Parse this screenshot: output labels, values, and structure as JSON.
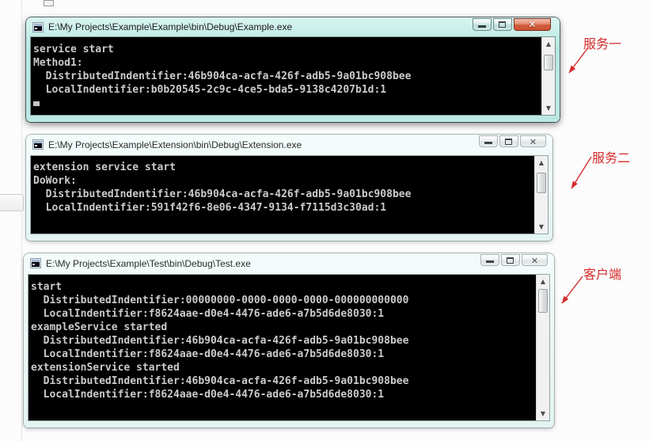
{
  "colors": {
    "annotation": "#d42a2a",
    "active_titlebar": "#bfe9e4",
    "close_button": "#d0573a",
    "console_background": "#000000",
    "console_text": "#cbcbcb"
  },
  "icons": {
    "close_glyph": "✕",
    "scroll_up_glyph": "▲",
    "scroll_down_glyph": "▼"
  },
  "annotations": [
    {
      "label": "服务一"
    },
    {
      "label": "服务二"
    },
    {
      "label": "客户端"
    }
  ],
  "windows": [
    {
      "title": "E:\\My Projects\\Example\\Example\\bin\\Debug\\Example.exe",
      "state": "active",
      "lines": [
        "service start",
        "Method1:",
        "  DistributedIndentifier:46b904ca-acfa-426f-adb5-9a01bc908bee",
        "  LocalIndentifier:b0b20545-2c9c-4ce5-bda5-9138c4207b1d:1"
      ],
      "cursor_visible": true
    },
    {
      "title": "E:\\My Projects\\Example\\Extension\\bin\\Debug\\Extension.exe",
      "state": "inactive",
      "lines": [
        "extension service start",
        "DoWork:",
        "  DistributedIndentifier:46b904ca-acfa-426f-adb5-9a01bc908bee",
        "  LocalIndentifier:591f42f6-8e06-4347-9134-f7115d3c30ad:1"
      ],
      "cursor_visible": false
    },
    {
      "title": "E:\\My Projects\\Example\\Test\\bin\\Debug\\Test.exe",
      "state": "inactive",
      "lines": [
        "start",
        "  DistributedIndentifier:00000000-0000-0000-0000-000000000000",
        "  LocalIndentifier:f8624aae-d0e4-4476-ade6-a7b5d6de8030:1",
        "exampleService started",
        "  DistributedIndentifier:46b904ca-acfa-426f-adb5-9a01bc908bee",
        "  LocalIndentifier:f8624aae-d0e4-4476-ade6-a7b5d6de8030:1",
        "extensionService started",
        "  DistributedIndentifier:46b904ca-acfa-426f-adb5-9a01bc908bee",
        "  LocalIndentifier:f8624aae-d0e4-4476-ade6-a7b5d6de8030:1"
      ],
      "cursor_visible": false
    }
  ]
}
